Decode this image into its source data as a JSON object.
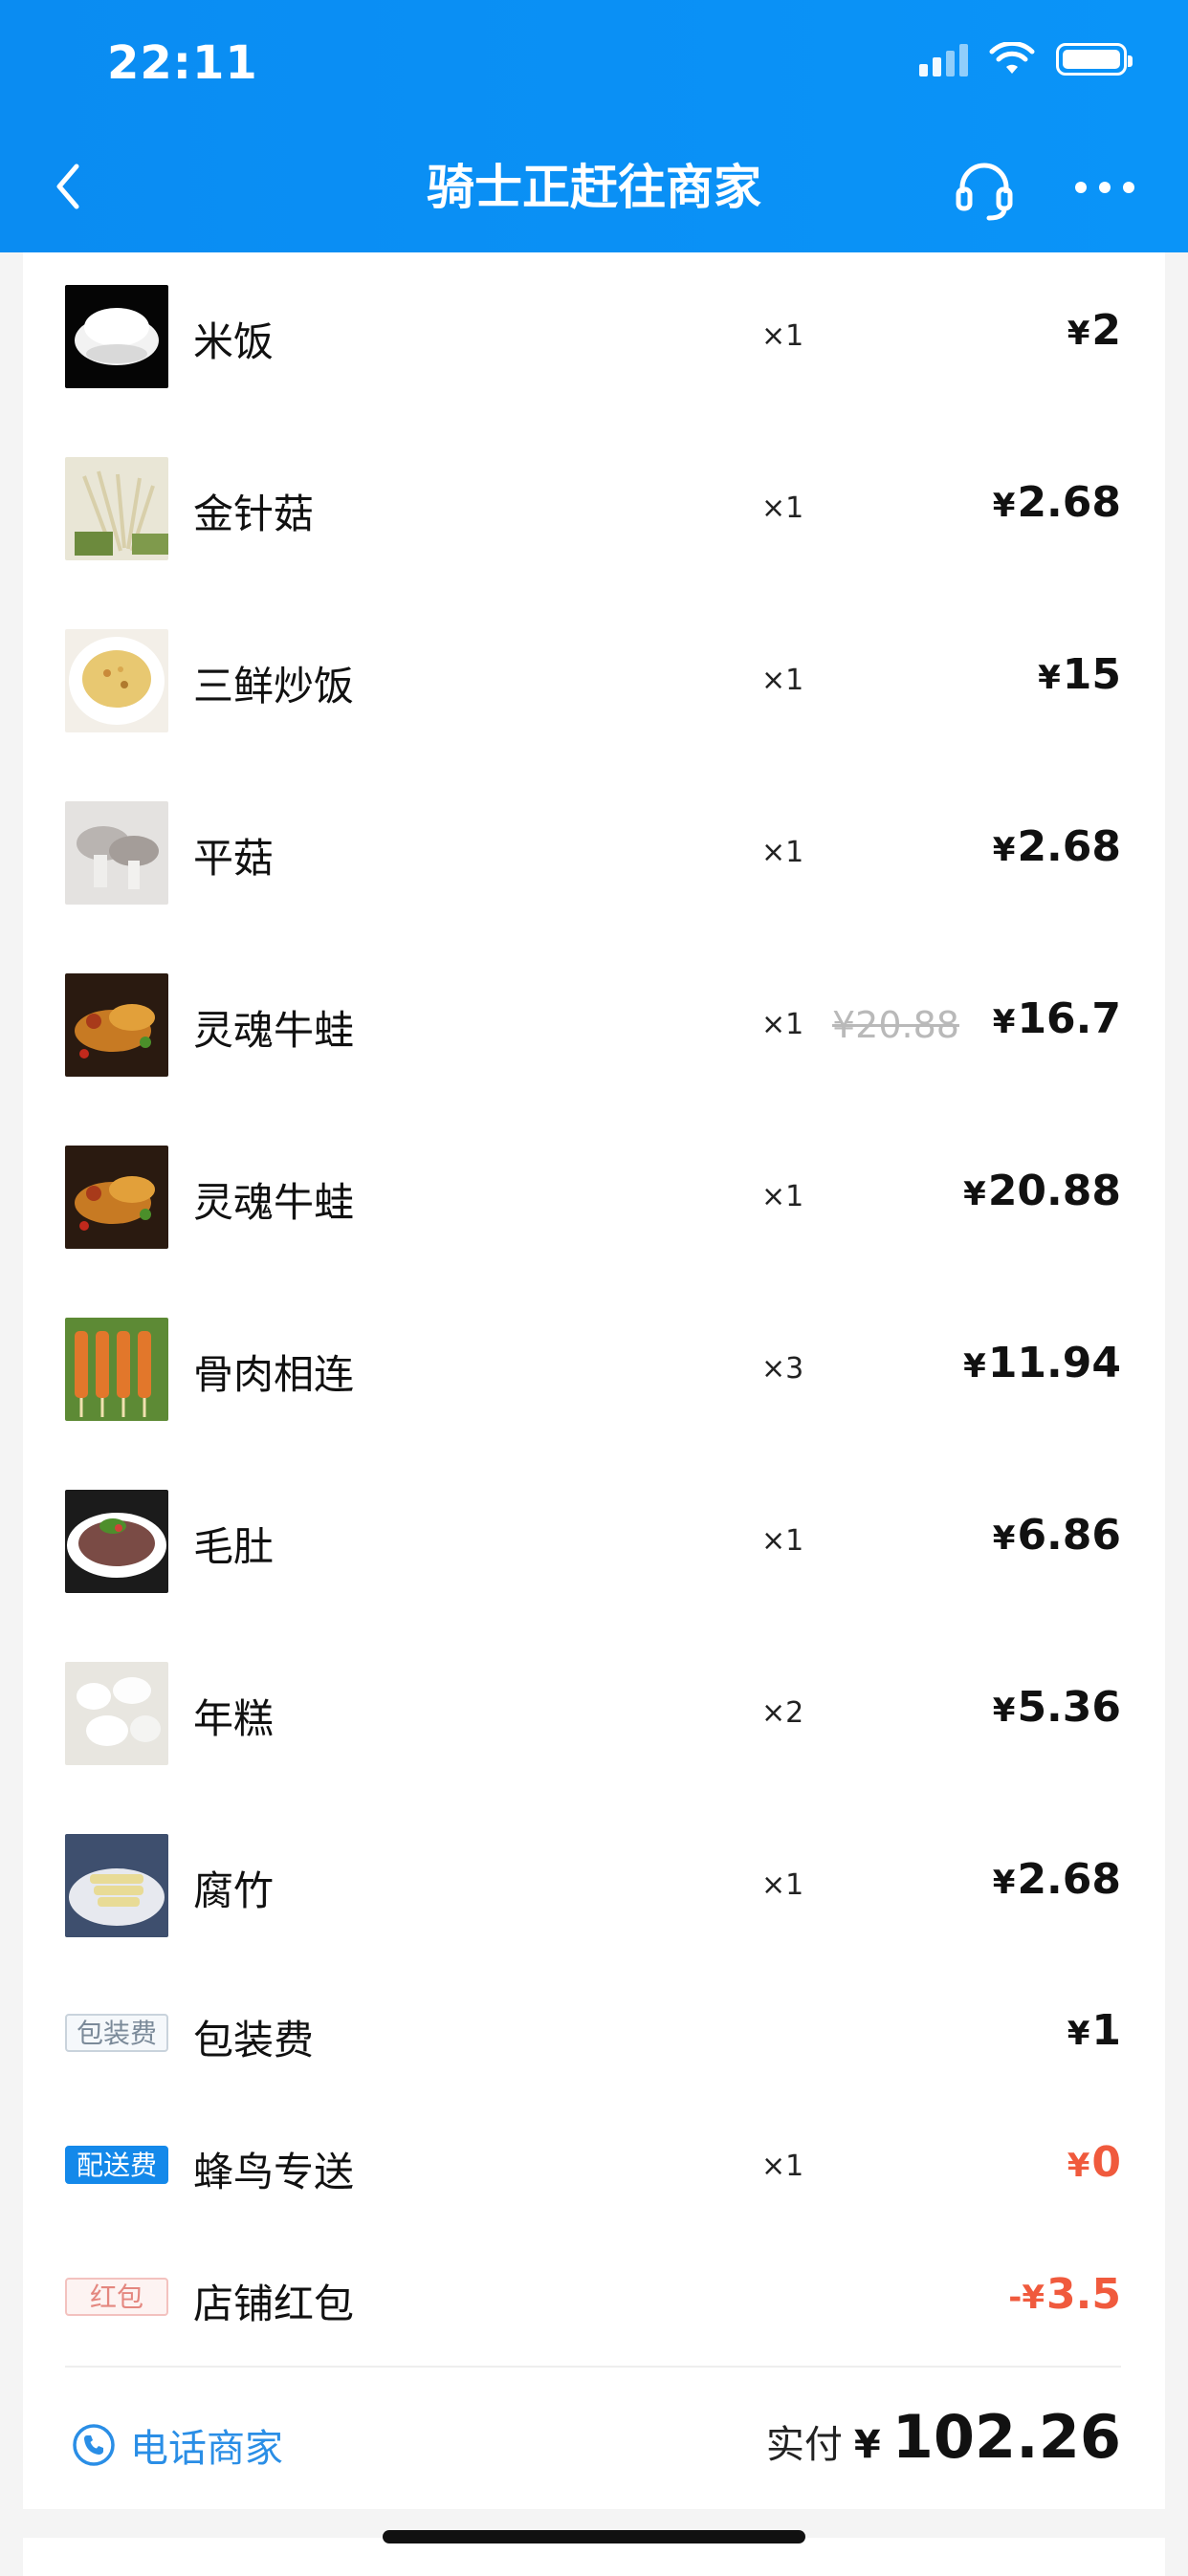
{
  "status_bar": {
    "time": "22:11"
  },
  "nav": {
    "title": "骑士正赶往商家"
  },
  "items": [
    {
      "name": "米饭",
      "qty": "×1",
      "price": "2"
    },
    {
      "name": "金针菇",
      "qty": "×1",
      "price": "2.68"
    },
    {
      "name": "三鲜炒饭",
      "qty": "×1",
      "price": "15"
    },
    {
      "name": "平菇",
      "qty": "×1",
      "price": "2.68"
    },
    {
      "name": "灵魂牛蛙",
      "qty": "×1",
      "original_price": "¥20.88",
      "price": "16.7"
    },
    {
      "name": "灵魂牛蛙",
      "qty": "×1",
      "price": "20.88"
    },
    {
      "name": "骨肉相连",
      "qty": "×3",
      "price": "11.94"
    },
    {
      "name": "毛肚",
      "qty": "×1",
      "price": "6.86"
    },
    {
      "name": "年糕",
      "qty": "×2",
      "price": "5.36"
    },
    {
      "name": "腐竹",
      "qty": "×1",
      "price": "2.68"
    }
  ],
  "fees": [
    {
      "tag": "包装费",
      "name": "包装费",
      "qty": "",
      "price": "1",
      "price_prefix": "¥"
    },
    {
      "tag": "配送费",
      "name": "蜂鸟专送",
      "qty": "×1",
      "price": "0",
      "price_prefix": "¥"
    },
    {
      "tag": "红包",
      "name": "店铺红包",
      "qty": "",
      "price": "3.5",
      "price_prefix": "-¥"
    }
  ],
  "footer": {
    "call_label": "电话商家",
    "total_label": "实付",
    "total_currency": "¥",
    "total_value": "102.26"
  },
  "colors": {
    "header_blue": "#0a8cf2",
    "accent_red": "#f05a3d",
    "link_blue": "#2a8ee6"
  }
}
